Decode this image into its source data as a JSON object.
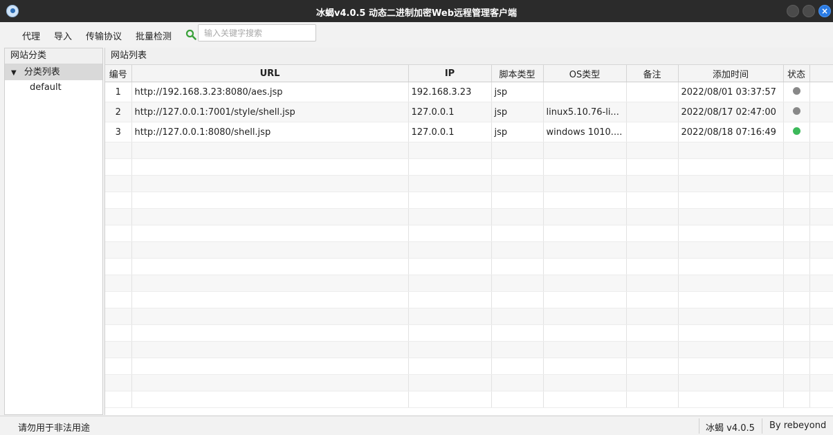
{
  "window": {
    "title": "冰蝎v4.0.5 动态二进制加密Web远程管理客户端"
  },
  "menu": {
    "items": [
      "代理",
      "导入",
      "传输协议",
      "批量检测"
    ],
    "search_placeholder": "输入关键字搜索"
  },
  "sidebar": {
    "header": "网站分类",
    "root_label": "分类列表",
    "children": [
      "default"
    ]
  },
  "main": {
    "header": "网站列表",
    "columns": [
      "编号",
      "URL",
      "IP",
      "脚本类型",
      "OS类型",
      "备注",
      "添加时间",
      "状态"
    ],
    "rows": [
      {
        "id": "1",
        "url": "http://192.168.3.23:8080/aes.jsp",
        "ip": "192.168.3.23",
        "script": "jsp",
        "os": "",
        "note": "",
        "time": "2022/08/01 03:37:57",
        "status": "offline"
      },
      {
        "id": "2",
        "url": "http://127.0.0.1:7001/style/shell.jsp",
        "ip": "127.0.0.1",
        "script": "jsp",
        "os": "linux5.10.76-li...",
        "note": "",
        "time": "2022/08/17 02:47:00",
        "status": "offline"
      },
      {
        "id": "3",
        "url": "http://127.0.0.1:8080/shell.jsp",
        "ip": "127.0.0.1",
        "script": "jsp",
        "os": "windows 1010....",
        "note": "",
        "time": "2022/08/18 07:16:49",
        "status": "online"
      }
    ]
  },
  "status_colors": {
    "offline": "#888888",
    "online": "#3cb95a"
  },
  "statusbar": {
    "warning": "请勿用于非法用途",
    "version": "冰蝎 v4.0.5",
    "author": "By rebeyond"
  }
}
